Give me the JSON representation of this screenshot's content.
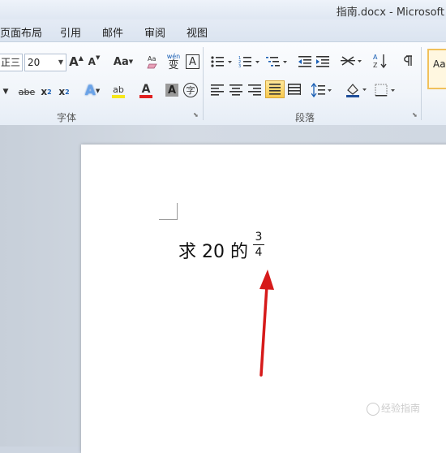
{
  "window": {
    "title": "指南.docx  -  Microsoft"
  },
  "menu": {
    "items": [
      "页面布局",
      "引用",
      "邮件",
      "审阅",
      "视图"
    ]
  },
  "ribbon": {
    "font": {
      "name_value": "正三",
      "size_value": "20",
      "grow_label": "A",
      "shrink_label": "A",
      "change_case_label": "Aa",
      "phonetic_label": "wén",
      "phonetic_char": "变",
      "border_label": "A",
      "strike_label": "abe",
      "subscript_label": "x",
      "subscript_sub": "2",
      "superscript_label": "x",
      "superscript_sup": "2",
      "effects_label": "A",
      "highlight_label": "ab",
      "color_label": "A",
      "shading_label": "A",
      "enclose_label": "字",
      "group_label": "字体"
    },
    "paragraph": {
      "group_label": "段落"
    },
    "styles": {
      "preview_label": "AaI"
    },
    "colors": {
      "highlight": "#f6e71a",
      "font_color": "#e02020",
      "shading": "#1f4e9a"
    }
  },
  "document": {
    "text_main": "求 20 的",
    "fraction_numerator": "3",
    "fraction_denominator": "4"
  },
  "annotation": {
    "arrow_color": "#d61a1a"
  },
  "watermark": {
    "text": "经验指南"
  }
}
